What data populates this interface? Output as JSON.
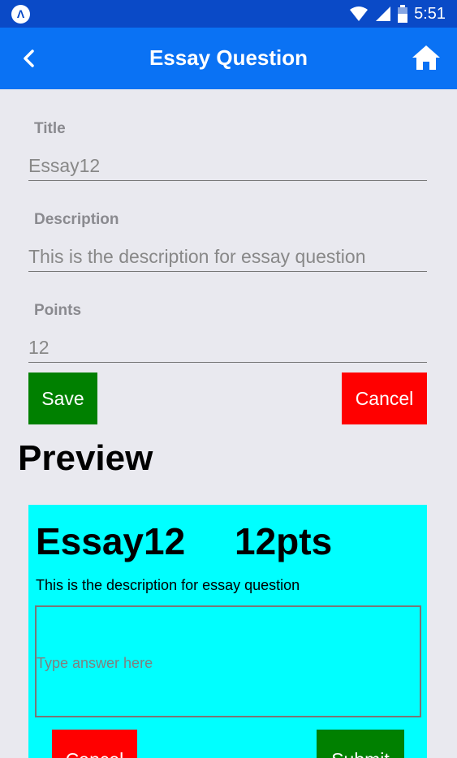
{
  "status_bar": {
    "time": "5:51"
  },
  "app_bar": {
    "title": "Essay Question"
  },
  "form": {
    "title_label": "Title",
    "title_value": "Essay12",
    "description_label": "Description",
    "description_value": "This is the description for essay question",
    "points_label": "Points",
    "points_value": "12",
    "save_label": "Save",
    "cancel_label": "Cancel"
  },
  "preview": {
    "heading": "Preview",
    "title": "Essay12",
    "points": "12pts",
    "description": "This is the description for essay question",
    "answer_placeholder": "Type answer here",
    "cancel_label": "Cancel",
    "submit_label": "Submit"
  },
  "colors": {
    "status_bar": "#0a4ac7",
    "app_bar": "#0a72f4",
    "background": "#e9e9ef",
    "save_button": "#008000",
    "cancel_button": "#ff0000",
    "preview_card": "#00ffff"
  },
  "icons": [
    "app-logo-icon",
    "wifi-icon",
    "cell-signal-icon",
    "battery-icon",
    "back-arrow-icon",
    "home-icon"
  ]
}
